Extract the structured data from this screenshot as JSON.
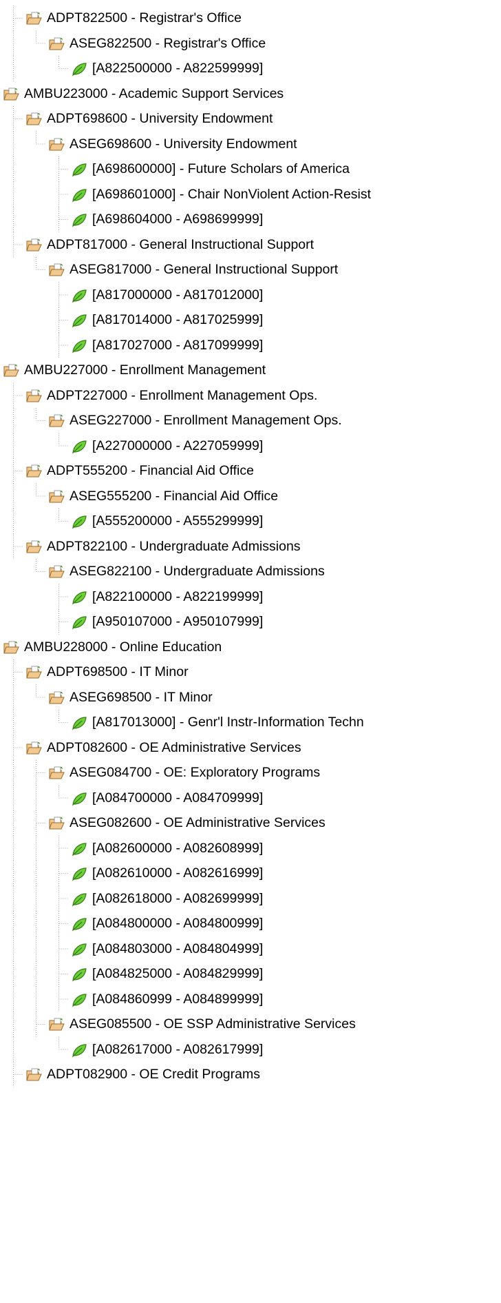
{
  "tree": {
    "nodes": [
      {
        "label": "ADPT822500 - Registrar's Office",
        "type": "folder",
        "depth": 2,
        "last": false
      },
      {
        "label": "ASEG822500 - Registrar's Office",
        "type": "folder",
        "depth": 3,
        "last": true
      },
      {
        "label": "[A822500000 - A822599999]",
        "type": "leaf",
        "depth": 4,
        "last": true
      },
      {
        "label": "AMBU223000 - Academic Support Services",
        "type": "folder",
        "depth": 1,
        "last": false
      },
      {
        "label": "ADPT698600 - University Endowment",
        "type": "folder",
        "depth": 2,
        "last": false
      },
      {
        "label": "ASEG698600 - University Endowment",
        "type": "folder",
        "depth": 3,
        "last": true
      },
      {
        "label": "[A698600000] - Future Scholars of America",
        "type": "leaf",
        "depth": 4,
        "last": false
      },
      {
        "label": "[A698601000] - Chair NonViolent Action-Resist",
        "type": "leaf",
        "depth": 4,
        "last": false
      },
      {
        "label": "[A698604000 - A698699999]",
        "type": "leaf",
        "depth": 4,
        "last": true
      },
      {
        "label": "ADPT817000 - General Instructional Support",
        "type": "folder",
        "depth": 2,
        "last": true
      },
      {
        "label": "ASEG817000 - General Instructional Support",
        "type": "folder",
        "depth": 3,
        "last": true
      },
      {
        "label": "[A817000000 - A817012000]",
        "type": "leaf",
        "depth": 4,
        "last": false
      },
      {
        "label": "[A817014000 - A817025999]",
        "type": "leaf",
        "depth": 4,
        "last": false
      },
      {
        "label": "[A817027000 - A817099999]",
        "type": "leaf",
        "depth": 4,
        "last": true
      },
      {
        "label": "AMBU227000 - Enrollment Management",
        "type": "folder",
        "depth": 1,
        "last": false
      },
      {
        "label": "ADPT227000 - Enrollment Management Ops.",
        "type": "folder",
        "depth": 2,
        "last": false
      },
      {
        "label": "ASEG227000 - Enrollment Management Ops.",
        "type": "folder",
        "depth": 3,
        "last": true
      },
      {
        "label": "[A227000000 - A227059999]",
        "type": "leaf",
        "depth": 4,
        "last": true
      },
      {
        "label": "ADPT555200 - Financial Aid Office",
        "type": "folder",
        "depth": 2,
        "last": false
      },
      {
        "label": "ASEG555200 - Financial Aid Office",
        "type": "folder",
        "depth": 3,
        "last": true
      },
      {
        "label": "[A555200000 - A555299999]",
        "type": "leaf",
        "depth": 4,
        "last": true
      },
      {
        "label": "ADPT822100 - Undergraduate Admissions",
        "type": "folder",
        "depth": 2,
        "last": true
      },
      {
        "label": "ASEG822100 - Undergraduate Admissions",
        "type": "folder",
        "depth": 3,
        "last": true
      },
      {
        "label": "[A822100000 - A822199999]",
        "type": "leaf",
        "depth": 4,
        "last": false
      },
      {
        "label": "[A950107000 - A950107999]",
        "type": "leaf",
        "depth": 4,
        "last": true
      },
      {
        "label": "AMBU228000 - Online Education",
        "type": "folder",
        "depth": 1,
        "last": true
      },
      {
        "label": "ADPT698500 - IT Minor",
        "type": "folder",
        "depth": 2,
        "last": false
      },
      {
        "label": "ASEG698500 - IT Minor",
        "type": "folder",
        "depth": 3,
        "last": true
      },
      {
        "label": "[A817013000] - Genr'l Instr-Information Techn",
        "type": "leaf",
        "depth": 4,
        "last": true
      },
      {
        "label": "ADPT082600 - OE Administrative Services",
        "type": "folder",
        "depth": 2,
        "last": false
      },
      {
        "label": "ASEG084700 - OE: Exploratory Programs",
        "type": "folder",
        "depth": 3,
        "last": false
      },
      {
        "label": "[A084700000 - A084709999]",
        "type": "leaf",
        "depth": 4,
        "last": true
      },
      {
        "label": "ASEG082600 - OE Administrative Services",
        "type": "folder",
        "depth": 3,
        "last": false
      },
      {
        "label": "[A082600000 - A082608999]",
        "type": "leaf",
        "depth": 4,
        "last": false
      },
      {
        "label": "[A082610000 - A082616999]",
        "type": "leaf",
        "depth": 4,
        "last": false
      },
      {
        "label": "[A082618000 - A082699999]",
        "type": "leaf",
        "depth": 4,
        "last": false
      },
      {
        "label": "[A084800000 - A084800999]",
        "type": "leaf",
        "depth": 4,
        "last": false
      },
      {
        "label": "[A084803000 - A084804999]",
        "type": "leaf",
        "depth": 4,
        "last": false
      },
      {
        "label": "[A084825000 - A084829999]",
        "type": "leaf",
        "depth": 4,
        "last": false
      },
      {
        "label": "[A084860999 - A084899999]",
        "type": "leaf",
        "depth": 4,
        "last": true
      },
      {
        "label": "ASEG085500 - OE SSP Administrative Services",
        "type": "folder",
        "depth": 3,
        "last": true
      },
      {
        "label": "[A082617000 - A082617999]",
        "type": "leaf",
        "depth": 4,
        "last": true
      },
      {
        "label": "ADPT082900 - OE Credit Programs",
        "type": "folder",
        "depth": 2,
        "last": false
      }
    ]
  },
  "colors": {
    "connector": "#a0a0a0",
    "folder_fill": "#f0c890",
    "folder_edge": "#9b6a2a",
    "leaf_fill": "#6fcf3a",
    "leaf_edge": "#2f7d12",
    "text": "#000000"
  },
  "icons": {
    "folder": "open-folder-icon",
    "leaf": "green-leaf-icon"
  }
}
